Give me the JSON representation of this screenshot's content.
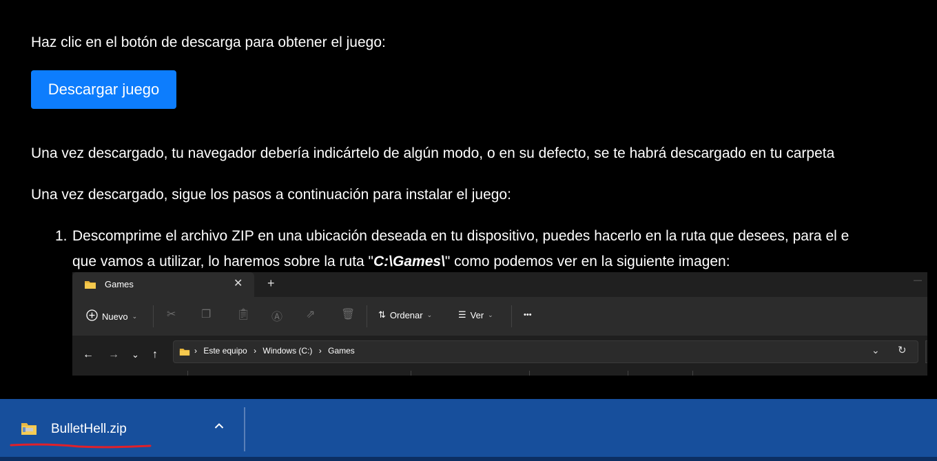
{
  "content": {
    "intro_text": "Haz clic en el botón de descarga para obtener el juego:",
    "download_button": "Descargar juego",
    "after_download_text": "Una vez descargado, tu navegador debería indicártelo de algún modo, o en su defecto, se te habrá descargado en tu carpeta",
    "steps_intro": "Una vez descargado, sigue los pasos a continuación para instalar el juego:",
    "step1_number": "1.",
    "step1_line1": "Descomprime el archivo ZIP en una ubicación deseada en tu dispositivo, puedes hacerlo en la ruta que desees, para el e",
    "step1_line2_pre": "que vamos a utilizar, lo haremos sobre la ruta \"",
    "step1_path": "C:\\Games\\",
    "step1_line2_post": "\" como podemos ver en la siguiente imagen:"
  },
  "explorer": {
    "tab_title": "Games",
    "tab_close": "✕",
    "new_tab": "+",
    "new_label": "Nuevo",
    "sort_label": "Ordenar",
    "view_label": "Ver",
    "more_label": "•••",
    "breadcrumbs": [
      "Este equipo",
      "Windows (C:)",
      "Games"
    ]
  },
  "download_bar": {
    "file_name": "BulletHell.zip",
    "chevron": "⌃"
  },
  "colors": {
    "background": "#000000",
    "button": "#0d7dfd",
    "download_bar": "#174f9c",
    "underline": "#e0202a"
  }
}
